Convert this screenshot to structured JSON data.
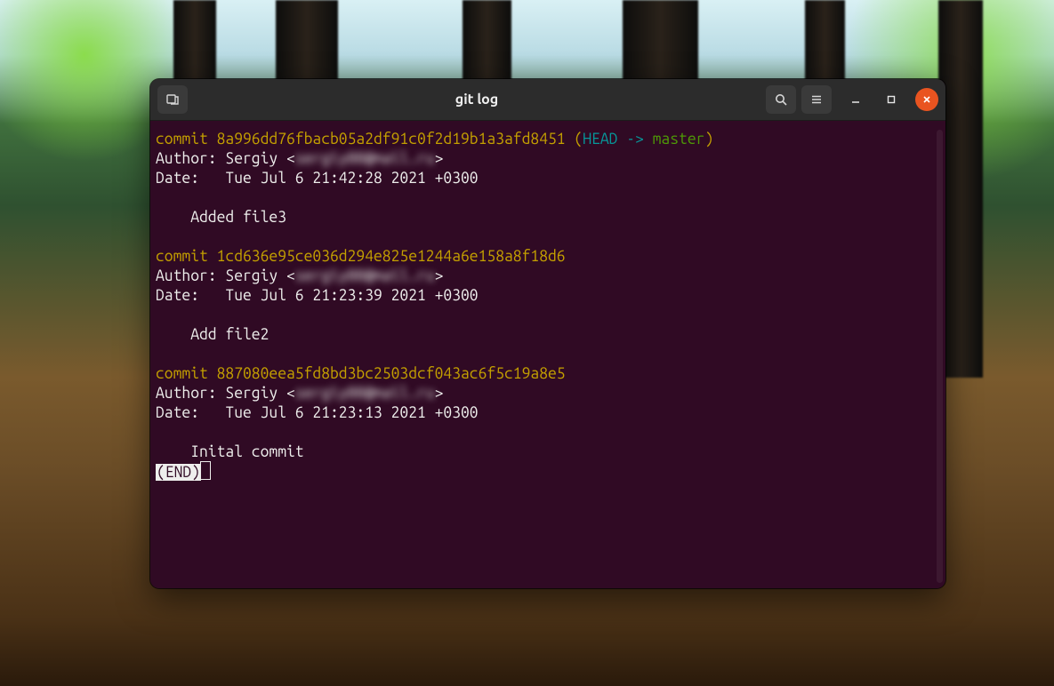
{
  "window": {
    "title": "git log"
  },
  "log": {
    "commits": [
      {
        "commit_prefix": "commit ",
        "hash": "8a996dd76fbacb05a2df91c0f2d19b1a3afd8451",
        "ref_open": " (",
        "ref_head": "HEAD -> ",
        "ref_branch": "master",
        "ref_close": ")",
        "author_label": "Author: ",
        "author_name": "Sergiy",
        "author_open": " <",
        "author_email": "sergiy00@mail.ru",
        "author_close": ">",
        "date_label": "Date:   ",
        "date_value": "Tue Jul 6 21:42:28 2021 +0300",
        "msg_indent": "    ",
        "msg": "Added file3"
      },
      {
        "commit_prefix": "commit ",
        "hash": "1cd636e95ce036d294e825e1244a6e158a8f18d6",
        "author_label": "Author: ",
        "author_name": "Sergiy",
        "author_open": " <",
        "author_email": "sergiy00@mail.ru",
        "author_close": ">",
        "date_label": "Date:   ",
        "date_value": "Tue Jul 6 21:23:39 2021 +0300",
        "msg_indent": "    ",
        "msg": "Add file2"
      },
      {
        "commit_prefix": "commit ",
        "hash": "887080eea5fd8bd3bc2503dcf043ac6f5c19a8e5",
        "author_label": "Author: ",
        "author_name": "Sergiy",
        "author_open": " <",
        "author_email": "sergiy00@mail.ru",
        "author_close": ">",
        "date_label": "Date:   ",
        "date_value": "Tue Jul 6 21:23:13 2021 +0300",
        "msg_indent": "    ",
        "msg": "Inital commit"
      }
    ],
    "end_marker": "(END)"
  }
}
